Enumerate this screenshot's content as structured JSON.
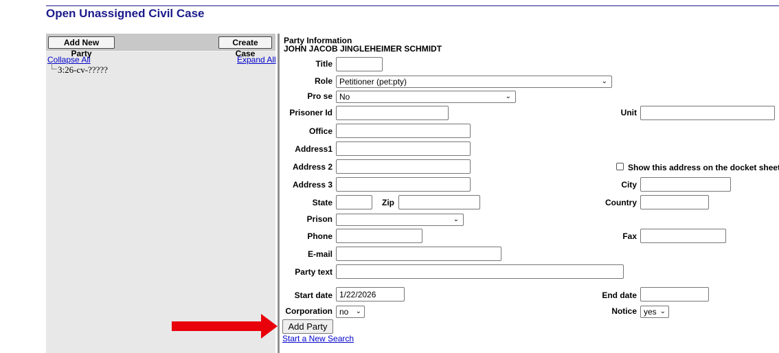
{
  "page": {
    "title": "Open Unassigned Civil Case"
  },
  "left_panel": {
    "add_new_party": "Add New Party",
    "create_case": "Create Case",
    "collapse_all": "Collapse All",
    "expand_all": "Expand All",
    "tree_item": "3:26-cv-?????"
  },
  "form": {
    "section_title": "Party Information",
    "party_name": "JOHN JACOB JINGLEHEIMER SCHMIDT",
    "labels": {
      "title": "Title",
      "role": "Role",
      "pro_se": "Pro se",
      "prisoner_id": "Prisoner Id",
      "unit": "Unit",
      "office": "Office",
      "address1": "Address1",
      "address2": "Address 2",
      "address3": "Address 3",
      "show_address": "Show this address on the docket sheet",
      "city": "City",
      "state": "State",
      "zip": "Zip",
      "country": "Country",
      "prison": "Prison",
      "phone": "Phone",
      "fax": "Fax",
      "email": "E-mail",
      "party_text": "Party text",
      "start_date": "Start date",
      "end_date": "End date",
      "corporation": "Corporation",
      "notice": "Notice"
    },
    "values": {
      "title": "",
      "role": "Petitioner (pet:pty)",
      "pro_se": "No",
      "prisoner_id": "",
      "unit": "",
      "office": "",
      "address1": "",
      "address2": "",
      "address3": "",
      "show_address_checked": false,
      "city": "",
      "state": "",
      "zip": "",
      "country": "",
      "prison": "",
      "phone": "",
      "fax": "",
      "email": "",
      "party_text": "",
      "start_date": "1/22/2026",
      "end_date": "",
      "corporation": "no",
      "notice": "yes"
    },
    "add_party_button": "Add Party",
    "start_new_search": "Start a New Search"
  },
  "icons": {
    "dropdown": "chevron-down-icon",
    "annotation": "red-arrow-icon"
  },
  "colors": {
    "title": "#1a1a8c",
    "link": "#0000cc",
    "arrow": "#e8000b",
    "panel_bg": "#e8e8e8"
  }
}
